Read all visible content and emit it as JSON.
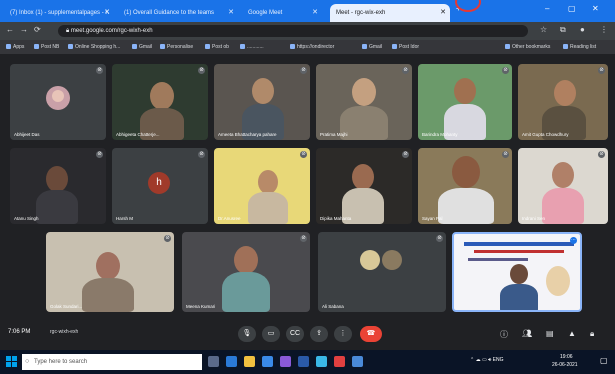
{
  "browser": {
    "tabs": [
      {
        "title": "(7) Inbox (1) - supplementalpages - K",
        "active": false
      },
      {
        "title": "(1) Overall Guidance to the teams",
        "active": false
      },
      {
        "title": "Google Meet",
        "active": false
      },
      {
        "title": "Meet - rgc-wix-exh",
        "active": true
      }
    ],
    "address": "meet.google.com/rgc-wixh-exh",
    "bookmarks": [
      "Apps",
      "Post NB",
      "Online Shopping h...",
      "Gmail",
      "Personalise",
      "Post ob",
      "............",
      "https://ondirector",
      "Gmail",
      "Post Idor",
      "Other bookmarks",
      "Reading list"
    ]
  },
  "participants": [
    {
      "name": "Abhijeet Das"
    },
    {
      "name": "Abhigeeta Chatterje..."
    },
    {
      "name": "Ameeta Bhattacharya pahare"
    },
    {
      "name": "Pratima Majhi"
    },
    {
      "name": "Barindra Mohanty"
    },
    {
      "name": "Amit Gupta Chowdhury"
    },
    {
      "name": "Atanu Singh"
    },
    {
      "name": "Harsh M"
    },
    {
      "name": "Dr.Anusree"
    },
    {
      "name": "Dipika Mahanta"
    },
    {
      "name": "Sayan Pal"
    },
    {
      "name": "Indrani Sen"
    },
    {
      "name": "Golak Sundari..."
    },
    {
      "name": "Meena Kumari"
    },
    {
      "name": "Ali Sabana"
    },
    {
      "name": "Presentation"
    }
  ],
  "avatar_letter": "h",
  "controls": {
    "time": "7:06 PM",
    "meeting_code": "rgc-wixh-exh",
    "end_icon": "phone-end-icon"
  },
  "taskbar": {
    "search_placeholder": "Type here to search",
    "clock": "19:06",
    "date": "26-06-2021"
  },
  "colors": {
    "chrome_blue": "#1a73e8",
    "meet_bg": "#202124",
    "tile_bg": "#3c4043",
    "end_call": "#ea4335",
    "avatar_h": "#a03a2a"
  }
}
